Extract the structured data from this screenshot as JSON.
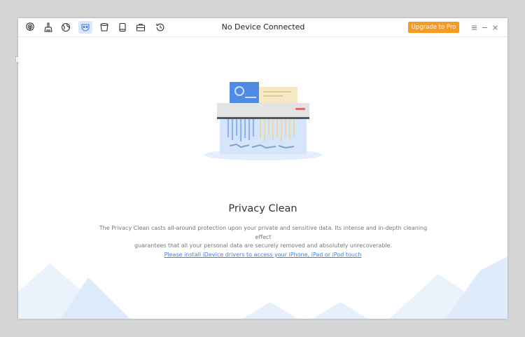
{
  "window": {
    "title": "No Device Connected",
    "upgrade_label": "Upgrade to Pro"
  },
  "toolbar": {
    "icons": [
      "podcast-icon",
      "broom-icon",
      "globe-icon",
      "mask-icon",
      "bucket-icon",
      "book-icon",
      "briefcase-icon",
      "history-icon"
    ],
    "active": "mask-icon"
  },
  "main": {
    "heading": "Privacy Clean",
    "description_line1": "The Privacy Clean casts all-around protection upon your private and sensitive data. Its intense and in-depth cleaning effect",
    "description_line2": "guarantees that all your personal data are securely removed and absolutely unrecoverable.",
    "link_text": "Please install iDevice drivers to access your iPhone, iPad or iPod touch"
  },
  "colors": {
    "accent": "#f59a23",
    "link": "#3f7fe0",
    "active_tool_bg": "#dbe8fb"
  }
}
